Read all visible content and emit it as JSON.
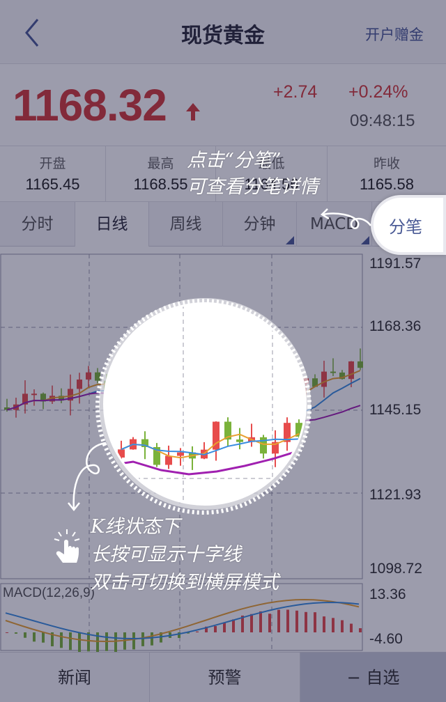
{
  "header": {
    "title": "现货黄金",
    "right_link": "开户赠金",
    "back_icon": "chevron-left-icon"
  },
  "quote": {
    "price": "1168.32",
    "change": "+2.74",
    "change_pct": "+0.24%",
    "time": "09:48:15",
    "trend_icon": "arrow-up-icon",
    "color": "#d23b3b"
  },
  "stats": [
    {
      "label": "开盘",
      "value": "1165.45"
    },
    {
      "label": "最高",
      "value": "1168.55"
    },
    {
      "label": "最低",
      "value": "1164.56"
    },
    {
      "label": "昨收",
      "value": "1165.58"
    }
  ],
  "tabs": [
    {
      "label": "分时"
    },
    {
      "label": "日线"
    },
    {
      "label": "周线"
    },
    {
      "label": "分钟"
    },
    {
      "label": "MACD"
    },
    {
      "label": "分笔"
    }
  ],
  "kline_axis": [
    "1191.57",
    "1168.36",
    "1145.15",
    "1121.93",
    "1098.72"
  ],
  "macd": {
    "label": "MACD(12,26,9)",
    "axis": [
      "13.36",
      "-4.60"
    ]
  },
  "bottom": {
    "news": "新闻",
    "alert": "预警",
    "watch": "− 自选"
  },
  "tutorial": {
    "tip_tab_line1": "点击“分笔”",
    "tip_tab_line2": "可查看分笔详情",
    "tip_chart_line1": "K线状态下",
    "tip_chart_line2": "长按可显示十字线",
    "tip_chart_line3": "双击可切换到横屏模式",
    "hand_icon": "pointing-hand-icon"
  },
  "colors": {
    "up": "#e74c4c",
    "down": "#7ab23a",
    "ma5": "#e8a030",
    "ma10": "#3a8de0",
    "ma20": "#a020b0",
    "accent": "#4b5b96"
  }
}
